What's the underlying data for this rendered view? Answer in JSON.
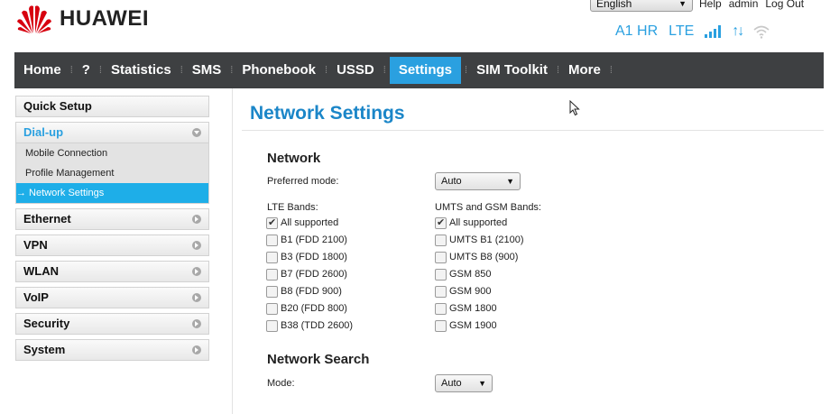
{
  "header": {
    "brand": "HUAWEI",
    "language": "English",
    "links": [
      "Help",
      "admin",
      "Log Out"
    ],
    "operator": "A1 HR",
    "network_type": "LTE",
    "colors": {
      "brand_red": "#d7000f",
      "accent": "#2aa0e0",
      "nav_bg": "#3e4042"
    }
  },
  "nav": {
    "items": [
      "Home",
      "?",
      "Statistics",
      "SMS",
      "Phonebook",
      "USSD",
      "Settings",
      "SIM Toolkit",
      "More"
    ],
    "active": "Settings"
  },
  "sidebar": {
    "sections": [
      {
        "label": "Quick Setup"
      },
      {
        "label": "Dial-up",
        "expanded": true,
        "items": [
          "Mobile Connection",
          "Profile Management",
          "→ Network Settings"
        ]
      },
      {
        "label": "Ethernet"
      },
      {
        "label": "VPN"
      },
      {
        "label": "WLAN"
      },
      {
        "label": "VoIP"
      },
      {
        "label": "Security"
      },
      {
        "label": "System"
      }
    ]
  },
  "main": {
    "title": "Network Settings",
    "network": {
      "heading": "Network",
      "preferred_mode_label": "Preferred mode:",
      "preferred_mode_value": "Auto",
      "lte_label": "LTE Bands:",
      "lte_bands": [
        {
          "label": "All supported",
          "checked": true
        },
        {
          "label": "B1 (FDD 2100)",
          "checked": false
        },
        {
          "label": "B3 (FDD 1800)",
          "checked": false
        },
        {
          "label": "B7 (FDD 2600)",
          "checked": false
        },
        {
          "label": "B8 (FDD 900)",
          "checked": false
        },
        {
          "label": "B20 (FDD 800)",
          "checked": false
        },
        {
          "label": "B38 (TDD 2600)",
          "checked": false
        }
      ],
      "umts_label": "UMTS and GSM Bands:",
      "umts_bands": [
        {
          "label": "All supported",
          "checked": true
        },
        {
          "label": "UMTS B1 (2100)",
          "checked": false
        },
        {
          "label": "UMTS B8 (900)",
          "checked": false
        },
        {
          "label": "GSM 850",
          "checked": false
        },
        {
          "label": "GSM 900",
          "checked": false
        },
        {
          "label": "GSM 1800",
          "checked": false
        },
        {
          "label": "GSM 1900",
          "checked": false
        }
      ]
    },
    "network_search": {
      "heading": "Network Search",
      "mode_label": "Mode:",
      "mode_value": "Auto"
    }
  }
}
